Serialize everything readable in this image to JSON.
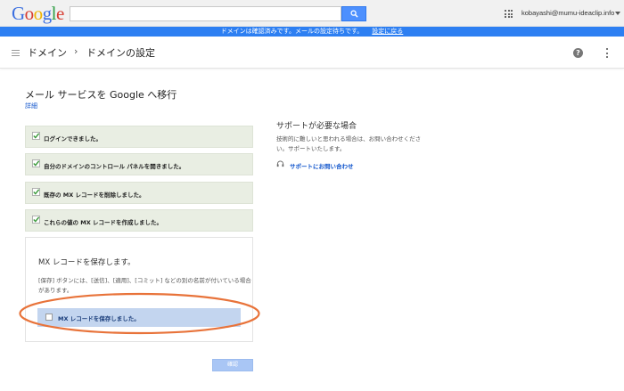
{
  "topbar": {
    "logo_letters": [
      "G",
      "o",
      "o",
      "g",
      "l",
      "e"
    ],
    "logo_colors": [
      "#3b6fe0",
      "#d73d32",
      "#f0b400",
      "#3b6fe0",
      "#2f9e44",
      "#d73d32"
    ],
    "search_value": "",
    "search_icon": "search-icon",
    "apps_icon": "apps-grid-icon",
    "account_email": "kobayashi@mumu-ideaclip.info"
  },
  "notice": {
    "text": "ドメインは確認済みです。メールの設定待ちです。",
    "link": "設定に戻る",
    "color": "#2d7ff2"
  },
  "header": {
    "menu_icon": "menu-icon",
    "breadcrumb": [
      "ドメイン",
      "ドメインの設定"
    ],
    "separator": "›",
    "help_icon": "help-icon",
    "help_glyph": "?",
    "more_icon": "more-vert-icon"
  },
  "main": {
    "title": "メール サービスを Google へ移行",
    "details_link": "詳細",
    "steps": [
      {
        "label": "ログインできました。",
        "checked": true
      },
      {
        "label": "自分のドメインのコントロール パネルを開きました。",
        "checked": true
      },
      {
        "label": "既存の MX レコードを削除しました。",
        "checked": true
      },
      {
        "label": "これらの値の MX レコードを作成しました。",
        "checked": true
      }
    ],
    "save_panel": {
      "title": "MX レコードを保存します。",
      "description": "[保存] ボタンには、[送信]、[適用]、[コミット] などの別の名前が付いている場合があります。",
      "confirm_label": "MX レコードを保存しました。",
      "confirm_checked": false
    },
    "confirm_button": "確認",
    "highlight_color": "#e8733a"
  },
  "support": {
    "title": "サポートが必要な場合",
    "text": "技術的に難しいと思われる場合は、お問い合わせください。サポートいたします。",
    "icon": "headset-icon",
    "link": "サポートにお問い合わせ"
  }
}
